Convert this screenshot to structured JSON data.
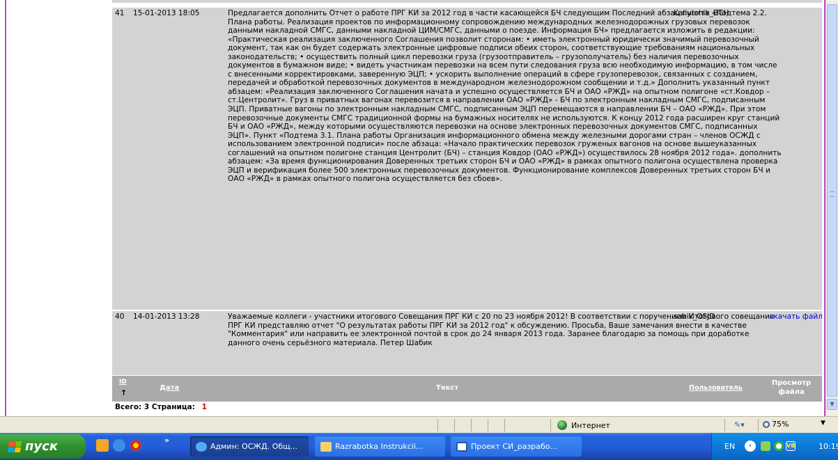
{
  "rows": [
    {
      "id": "41",
      "date": "15-01-2013 18:05",
      "text": "Предлагается дополнить Отчет о работе ПРГ КИ за 2012 год в части касающейся БЧ следующим Последний абзац пункта «Подтема 2.2. Плана работы. Реализация проектов по информационному сопровождению международных железнодорожных грузовых перевозок данными накладной СМГС, данными накладной ЦИМ/СМГС, данными о поезде. Информация БЧ» предлагается изложить в редакции: «Практическая реализация заключенного Соглашения позволит сторонам: • иметь электронный юридически значимый перевозочный документ, так как он будет содержать электронные цифровые подписи обеих сторон, соответствующие требованиям национальных законодательств; • осуществить полный цикл перевозки груза (грузоотправитель – грузополучатель) без наличия перевозочных документов в бумажном виде; • видеть участникам перевозки на всем пути следования груза всю необходимую информацию, в том числе с внесенными корректировками, заверенную ЭЦП; • ускорить выполнение операций в сфере грузоперевозок, связанных с созданием, передачей и обработкой перевозочных документов в международном железнодорожном сообщении и т.д.» Дополнить указанный пункт абзацем: «Реализация заключенного Соглашения начата и успешно осуществляется БЧ и ОАО «РЖД» на опытном полигоне «ст.Ковдор – ст.Центролит». Груз в приватных вагонах перевозится в направлении ОАО «РЖД» - БЧ по электронным накладным СМГС, подписанным ЭЦП. Приватные вагоны по электронным накладным СМГС, подписанным ЭЦП перемещаются в направлении БЧ – ОАО «РЖД». При этом перевозочные документы СМГС традиционной формы на бумажных носителях не используются. К концу 2012 года расширен круг станций БЧ и ОАО «РЖД», между которыми осуществляются перевозки на основе электронных перевозочных документов СМГС, подписанных ЭЦП». Пункт «Подтема 3.1. Плана работы Организация информационного обмена между железными дорогами стран – членов ОСЖД с использованием электронной подписи» после абзаца: «Начало практических перевозок груженых вагонов на основе вышеуказанных соглашений на опытном полигоне станция Центролит (БЧ) – станция Ковдор (ОАО «РЖД») осуществилось 28 ноября 2012 года». дополнить абзацем: «За время функционирования Доверенных третьих сторон БЧ и ОАО «РЖД» в рамках опытного полигона осуществлена проверка ЭЦП и верификация более 500 электронных перевозочных документов. Функционирование комплексов Доверенных третьих сторон БЧ и ОАО «РЖД» в рамках опытного полигона осуществляется без сбоев».",
      "user": "Kaliutchik_BCH",
      "file": ""
    },
    {
      "id": "40",
      "date": "14-01-2013 13:28",
      "text": "Уважаемые коллеги - участники итогового Совещания ПРГ КИ с 20 по 23 ноября 2012! В соответствии с поручением Итогового совещания ПРГ КИ представляю отчет \"О результатах работы ПРГ КИ за 2012 год\" к обсуждению. Просьба, Ваше замечания внести в качестве \"Комментария\" или направить ее электронной почтой в срок до 24 января 2013 года. Заранее благодарю за помощь при доработке данного очень серьёзного материала. Петер Шабик",
      "user": "sabik_OSJD",
      "file": "скачать файл"
    }
  ],
  "header": {
    "id": "ID",
    "date": "Дата",
    "text": "Текст",
    "user": "Пользователь",
    "file": "Просмотр файла"
  },
  "footer": {
    "total_label": "Всего: 3",
    "page_label": "Страница:",
    "page_number": "1"
  },
  "statusbar": {
    "zone": "Интернет",
    "zoom": "75%"
  },
  "taskbar": {
    "start": "пуск",
    "buttons": [
      "Админ: ОСЖД. Общ...",
      "Razrabotka Instrukcii...",
      "Проект СИ_разрабо..."
    ],
    "lang": "EN",
    "time": "10:19"
  }
}
